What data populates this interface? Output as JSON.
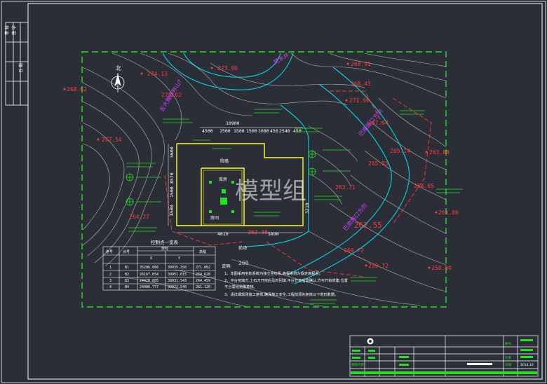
{
  "colors": {
    "background": "#2b2e36",
    "frame": "#ffffff",
    "border_green": "#22e022",
    "contour": "#d8d8d8",
    "elevation_red": "#ff3b3b",
    "road_cyan": "#00d7e6",
    "label_magenta": "#d040ff",
    "building_yellow": "#ffff22",
    "coord_green": "#22e022"
  },
  "north": {
    "label": "北"
  },
  "watermark": "模型组",
  "road_labels": {
    "left": "去大雅新畔山?",
    "top_right": "焚水井",
    "right_upper": "巴南路口方向",
    "right_lower": "巴南路口方向"
  },
  "elevations": {
    "e1": "274.13",
    "e2": "273.90",
    "e3": "272.62",
    "e4": "268.62",
    "e5": "267.54",
    "e6": "264.27",
    "e7": "268.91",
    "e8": "268.43",
    "e9": "271.00",
    "e10": "267.64",
    "e11": "265.95",
    "e12": "263.88",
    "e13": "265.14",
    "e14": "264.85",
    "e15": "263.71",
    "e16": "261.86",
    "e17": "262.55",
    "e18": "262.30",
    "e19": "260.72",
    "e20": "259.72",
    "e21": "258.80",
    "e22": "260"
  },
  "dimensions": {
    "top_total": "10900",
    "top_parts": [
      "4500",
      "1500",
      "1500",
      "1500",
      "1080",
      "450",
      "2540",
      "450"
    ],
    "bottom_inner": "4610",
    "bottom_total": "5890",
    "right_dim": "3210",
    "left_dims": [
      "5600",
      "8570",
      "1500",
      "4500"
    ]
  },
  "building_labels": {
    "a": "院墙",
    "b": "库房",
    "c": "房间",
    "d": "前场"
  },
  "table": {
    "title": "控制点一览表",
    "headers": [
      "序号",
      "点号",
      "坐标",
      "",
      "高程"
    ],
    "subheaders": [
      "X",
      "Y"
    ],
    "rows": [
      [
        "1",
        "B1",
        "35206.066",
        "39935.350",
        "271.002"
      ],
      [
        "2",
        "B2",
        "26167.054",
        "39951.015",
        "264.628"
      ],
      [
        "3",
        "B3",
        "24420.085",
        "39931.543",
        "264.459"
      ],
      [
        "4",
        "B4",
        "24406.777",
        "39922.540",
        "261.120"
      ]
    ]
  },
  "notes": {
    "heading": "说明:",
    "lines": [
      "1、本图采用坐标系统为独立坐标系,高程系统为假定高程系。",
      "2、平台挖填方,土石方开挖后及时回填,平台开挖后需确认,方可开始修建,位置",
      "   平台需经测量复核。",
      "3、请详细现场施工复核,确保施工安全,工程前须先复核以下地形数据。"
    ]
  },
  "title_block": {
    "row1": [
      "",
      "",
      "",
      "",
      ""
    ],
    "row2": [
      "图纸内容",
      "",
      "",
      "",
      ""
    ],
    "right": [
      "图号",
      "",
      "比例",
      "日期",
      "2014.10"
    ]
  }
}
